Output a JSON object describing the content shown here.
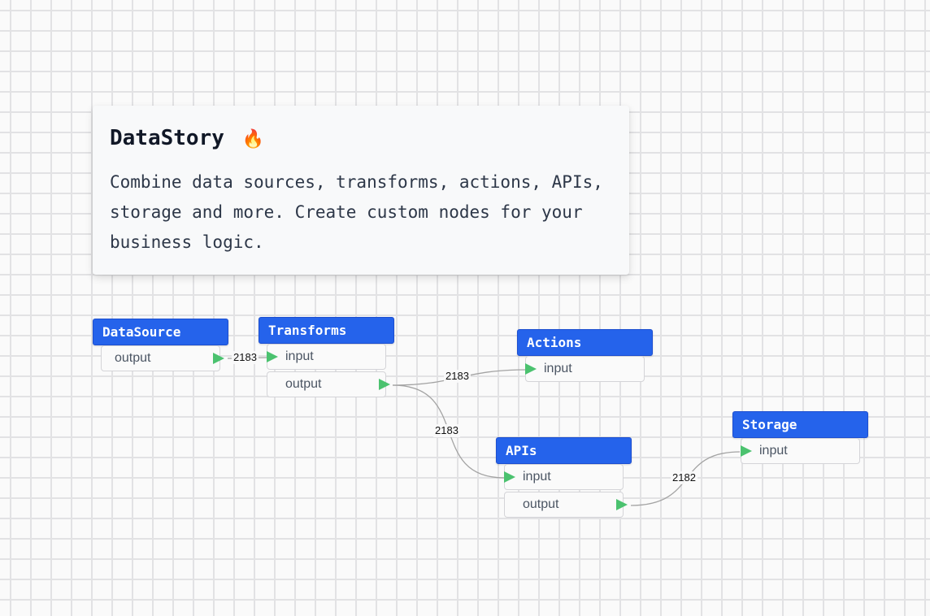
{
  "intro": {
    "title": "DataStory",
    "title_emoji": "🔥",
    "description": "Combine data sources, transforms, actions, APIs, storage and more. Create custom nodes for your business logic."
  },
  "diagram": {
    "nodes": [
      {
        "id": "datasource",
        "title": "DataSource",
        "inputs": [],
        "outputs": [
          "output"
        ]
      },
      {
        "id": "transforms",
        "title": "Transforms",
        "inputs": [
          "input"
        ],
        "outputs": [
          "output"
        ]
      },
      {
        "id": "actions",
        "title": "Actions",
        "inputs": [
          "input"
        ],
        "outputs": []
      },
      {
        "id": "apis",
        "title": "APIs",
        "inputs": [
          "input"
        ],
        "outputs": [
          "output"
        ]
      },
      {
        "id": "storage",
        "title": "Storage",
        "inputs": [
          "input"
        ],
        "outputs": []
      }
    ],
    "edges": [
      {
        "from": "datasource",
        "to": "transforms",
        "count": "2183"
      },
      {
        "from": "transforms",
        "to": "actions",
        "count": "2183"
      },
      {
        "from": "transforms",
        "to": "apis",
        "count": "2183"
      },
      {
        "from": "apis",
        "to": "storage",
        "count": "2182"
      }
    ]
  },
  "colors": {
    "node_header": "#2563eb",
    "port_arrow": "#4bc26f",
    "edge_stroke": "#a3a3a3",
    "grid_line": "#e2e2e4"
  }
}
